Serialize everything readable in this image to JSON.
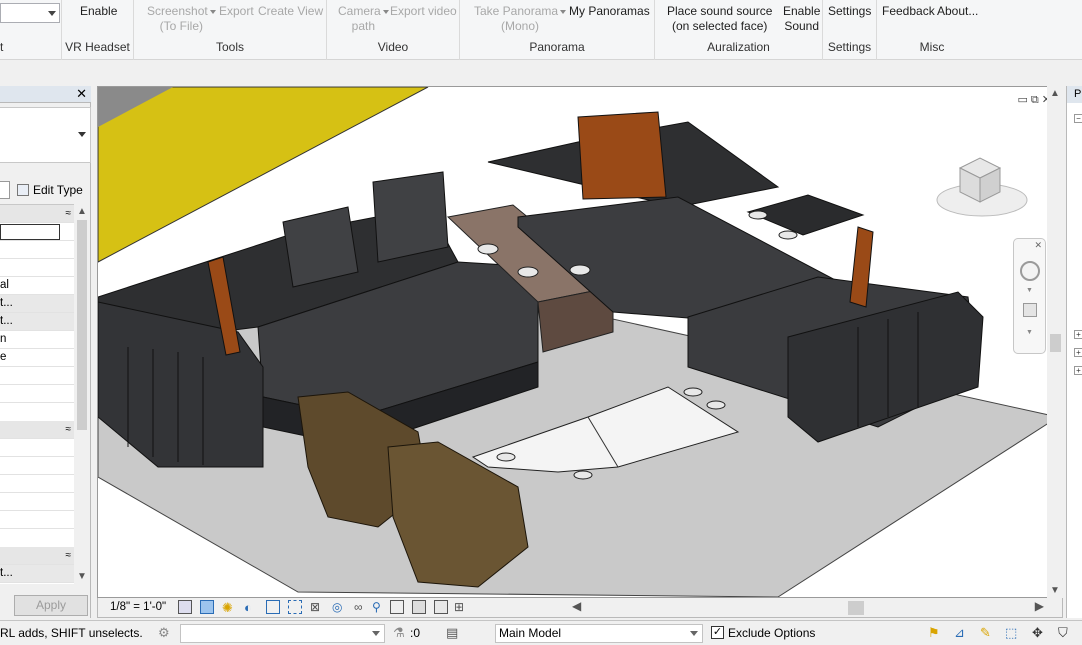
{
  "ribbon": {
    "partial_left_label": "t",
    "vr_headset": {
      "button": "Enable",
      "label": "VR Headset"
    },
    "tools": {
      "screenshot": "Screenshot",
      "screenshot_sub": "(To File)",
      "export": "Export",
      "create_view": "Create View",
      "label": "Tools"
    },
    "video": {
      "camera": "Camera",
      "camera_sub": "path",
      "export_video": "Export video",
      "label": "Video"
    },
    "panorama": {
      "take": "Take Panorama",
      "take_sub": "(Mono)",
      "my": "My Panoramas",
      "label": "Panorama"
    },
    "auralization": {
      "place": "Place sound source",
      "place_sub": "(on selected face)",
      "enable": "Enable",
      "enable_sub": "Sound",
      "label": "Auralization"
    },
    "settings": {
      "button": "Settings",
      "label": "Settings"
    },
    "misc": {
      "feedback": "Feedback",
      "about": "About...",
      "label": "Misc"
    }
  },
  "properties": {
    "edit_type": "Edit Type",
    "rows": [
      "",
      "",
      "",
      "al",
      "t...",
      "t...",
      "n",
      "e",
      "",
      ""
    ],
    "apply": "Apply"
  },
  "viewbar": {
    "scale": "1/8\" = 1'-0\""
  },
  "status": {
    "message": "RL adds, SHIFT unselects.",
    "filter_count": ":0",
    "model": "Main Model",
    "exclude_options": "Exclude Options"
  },
  "right_panel": {
    "header": "Pr"
  },
  "colors": {
    "sofa": "#3a3b3d",
    "sofa_dark": "#26272a",
    "pillow_orange": "#9a4a17",
    "armchair": "#5e4a2c",
    "rug": "#c9c9c9",
    "floor_yellow": "#d6c114",
    "coffee_table": "#f4f4f4",
    "side_table": "#8a7468"
  }
}
